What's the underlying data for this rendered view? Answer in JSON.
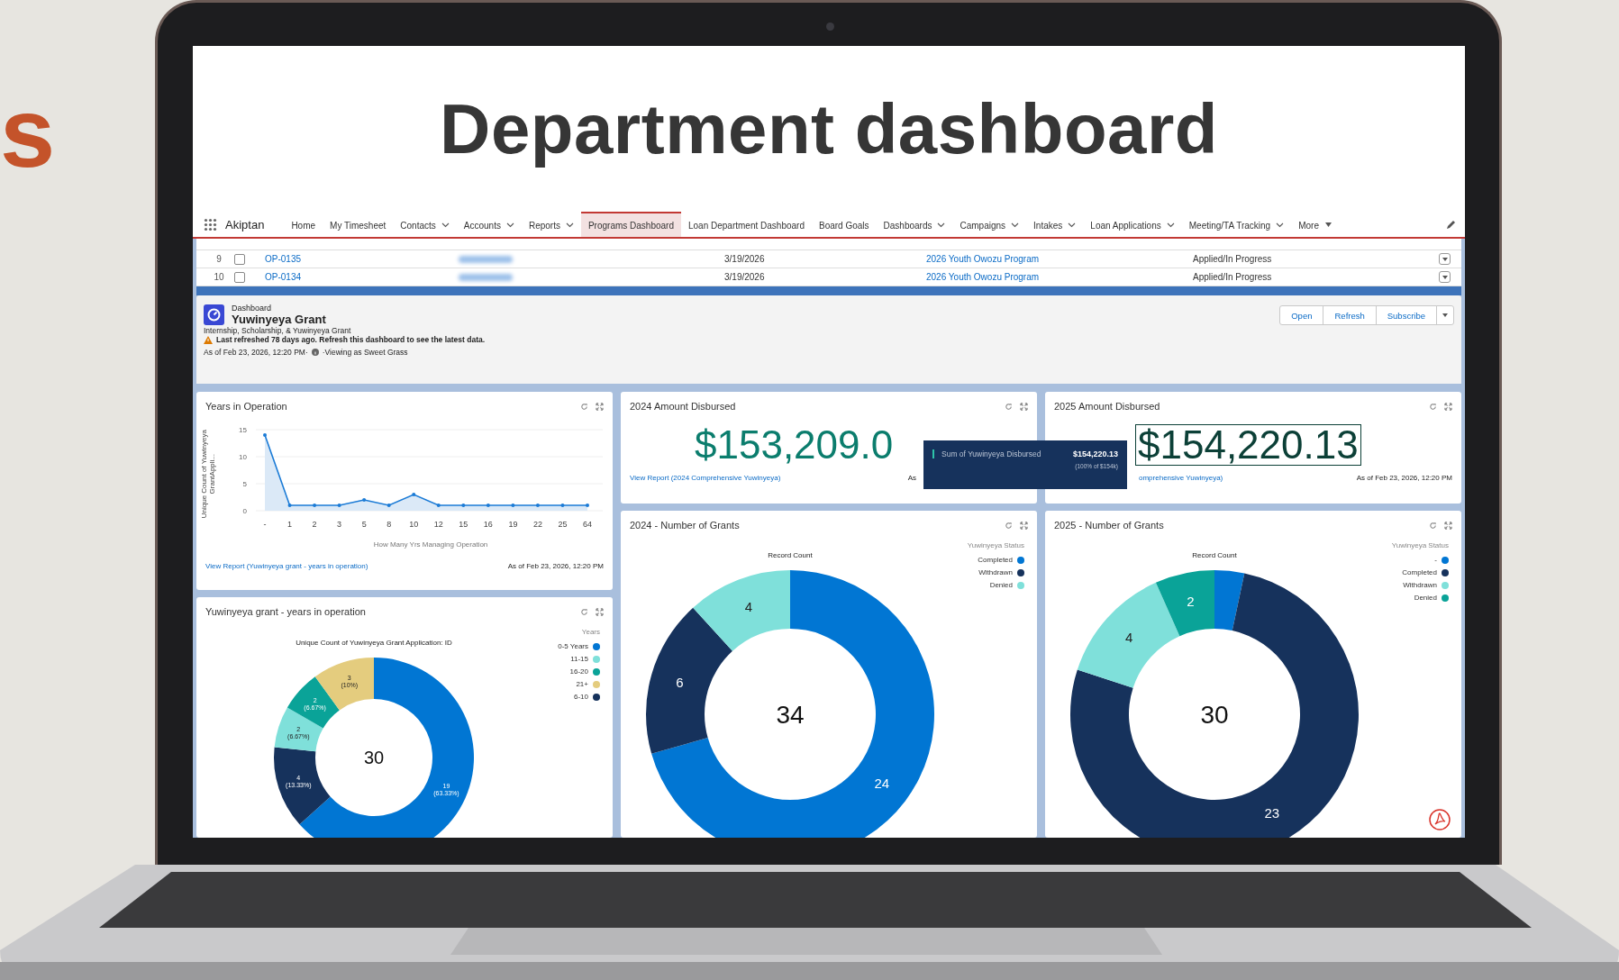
{
  "side_text": "s",
  "page_title": "Department dashboard",
  "nav": {
    "app_name": "Akiptan",
    "items": [
      {
        "label": "Home",
        "selected": false,
        "kind": "link"
      },
      {
        "label": "My Timesheet",
        "selected": false,
        "kind": "link"
      },
      {
        "label": "Contacts",
        "selected": false,
        "kind": "dropdown"
      },
      {
        "label": "Accounts",
        "selected": false,
        "kind": "dropdown"
      },
      {
        "label": "Reports",
        "selected": false,
        "kind": "dropdown"
      },
      {
        "label": "Programs Dashboard",
        "selected": true,
        "kind": "link"
      },
      {
        "label": "Loan Department Dashboard",
        "selected": false,
        "kind": "link"
      },
      {
        "label": "Board Goals",
        "selected": false,
        "kind": "link"
      },
      {
        "label": "Dashboards",
        "selected": false,
        "kind": "dropdown"
      },
      {
        "label": "Campaigns",
        "selected": false,
        "kind": "dropdown"
      },
      {
        "label": "Intakes",
        "selected": false,
        "kind": "dropdown"
      },
      {
        "label": "Loan Applications",
        "selected": false,
        "kind": "dropdown"
      },
      {
        "label": "Meeting/TA Tracking",
        "selected": false,
        "kind": "dropdown"
      },
      {
        "label": "More",
        "selected": false,
        "kind": "more"
      }
    ]
  },
  "table": {
    "rows": [
      {
        "number": "9",
        "checked": false,
        "id": "OP-0135",
        "date": "3/19/2026",
        "program": "2026 Youth Owozu Program",
        "status": "Applied/In Progress"
      },
      {
        "number": "10",
        "checked": false,
        "id": "OP-0134",
        "date": "3/19/2026",
        "program": "2026 Youth Owozu Program",
        "status": "Applied/In Progress"
      }
    ]
  },
  "dashboard": {
    "type_label": "Dashboard",
    "title": "Yuwinyeya Grant",
    "subtitle": "Internship, Scholarship, & Yuwinyeya Grant",
    "warning": "Last refreshed 78 days ago. Refresh this dashboard to see the latest data.",
    "as_of": "As of Feb 23, 2026, 12:20 PM·",
    "viewing": "·Viewing as Sweet Grass",
    "buttons": [
      "Open",
      "Refresh",
      "Subscribe"
    ],
    "tooltip": {
      "label": "Sum of Yuwinyeya Disbursed",
      "value": "$154,220.13",
      "note": "(100% of $154k)"
    },
    "columns": [
      [
        {
          "kind": "line",
          "title": "Years in Operation",
          "link": "View Report (Yuwinyeya grant - years in operation)",
          "as_of": "As of Feb 23, 2026, 12:20 PM",
          "chart_data": {
            "type": "area",
            "xlabel": "How Many Yrs Managing Operation",
            "ylabel": "Unique Count of Yuwinyeya GrantAppli...",
            "categories": [
              "-",
              "1",
              "2",
              "3",
              "5",
              "8",
              "10",
              "12",
              "15",
              "16",
              "19",
              "22",
              "25",
              "64"
            ],
            "values": [
              14,
              1,
              1,
              1,
              2,
              1,
              3,
              1,
              1,
              1,
              1,
              1,
              1,
              1
            ],
            "ylim": [
              0,
              15
            ],
            "yticks": [
              0,
              5,
              10,
              15
            ]
          }
        },
        {
          "kind": "donut",
          "title": "Yuwinyeya grant - years in operation",
          "legend_title": "Years",
          "center": "30",
          "legend": [
            {
              "label": "0-5 Years",
              "color": "#0176d3"
            },
            {
              "label": "11-15",
              "color": "#7fe0da"
            },
            {
              "label": "16-20",
              "color": "#0aa398"
            },
            {
              "label": "21+",
              "color": "#e4cc7e"
            },
            {
              "label": "6-10",
              "color": "#16325c"
            }
          ],
          "chart_data": {
            "type": "donut",
            "title": "Unique Count of Yuwinyeya Grant Application: ID",
            "values": [
              19,
              4,
              2,
              2,
              3
            ],
            "colors": [
              "#0176d3",
              "#16325c",
              "#7fe0da",
              "#0aa398",
              "#e4cc7e"
            ],
            "value_labels": [
              "19 (63.33%)",
              "4 (13.33%)",
              "2 (6.67%)",
              "2 (6.67%)",
              "3 (10%)"
            ]
          }
        }
      ],
      [
        {
          "kind": "metric",
          "title": "2024 Amount Disbursed",
          "value": "$153,209.0",
          "outlined": false,
          "link": "View Report (2024 Comprehensive Yuwinyeya)",
          "as_of": "As"
        },
        {
          "kind": "donut",
          "title": "2024 - Number of Grants",
          "legend_title": "Yuwinyeya Status",
          "center": "34",
          "legend": [
            {
              "label": "Completed",
              "color": "#0176d3"
            },
            {
              "label": "Withdrawn",
              "color": "#16325c"
            },
            {
              "label": "Denied",
              "color": "#7fe0da"
            }
          ],
          "chart_data": {
            "type": "donut",
            "title": "Record Count",
            "values": [
              24,
              6,
              4
            ],
            "colors": [
              "#0176d3",
              "#16325c",
              "#7fe0da"
            ],
            "value_labels": [
              "24",
              "6",
              "4"
            ]
          }
        }
      ],
      [
        {
          "kind": "metric",
          "title": "2025 Amount Disbursed",
          "value": "$154,220.13",
          "outlined": true,
          "link": "omprehensive Yuwinyeya)",
          "as_of": "As of Feb 23, 2026, 12:20 PM"
        },
        {
          "kind": "donut",
          "title": "2025 - Number of Grants",
          "legend_title": "Yuwinyeya Status",
          "center": "30",
          "legend": [
            {
              "label": "-",
              "color": "#0176d3"
            },
            {
              "label": "Completed",
              "color": "#16325c"
            },
            {
              "label": "Withdrawn",
              "color": "#7fe0da"
            },
            {
              "label": "Denied",
              "color": "#0aa398"
            }
          ],
          "chart_data": {
            "type": "donut",
            "title": "Record Count",
            "values": [
              1,
              23,
              4,
              2
            ],
            "colors": [
              "#0176d3",
              "#16325c",
              "#7fe0da",
              "#0aa398"
            ],
            "value_labels": [
              null,
              "23",
              "4",
              "2"
            ]
          }
        }
      ]
    ]
  }
}
